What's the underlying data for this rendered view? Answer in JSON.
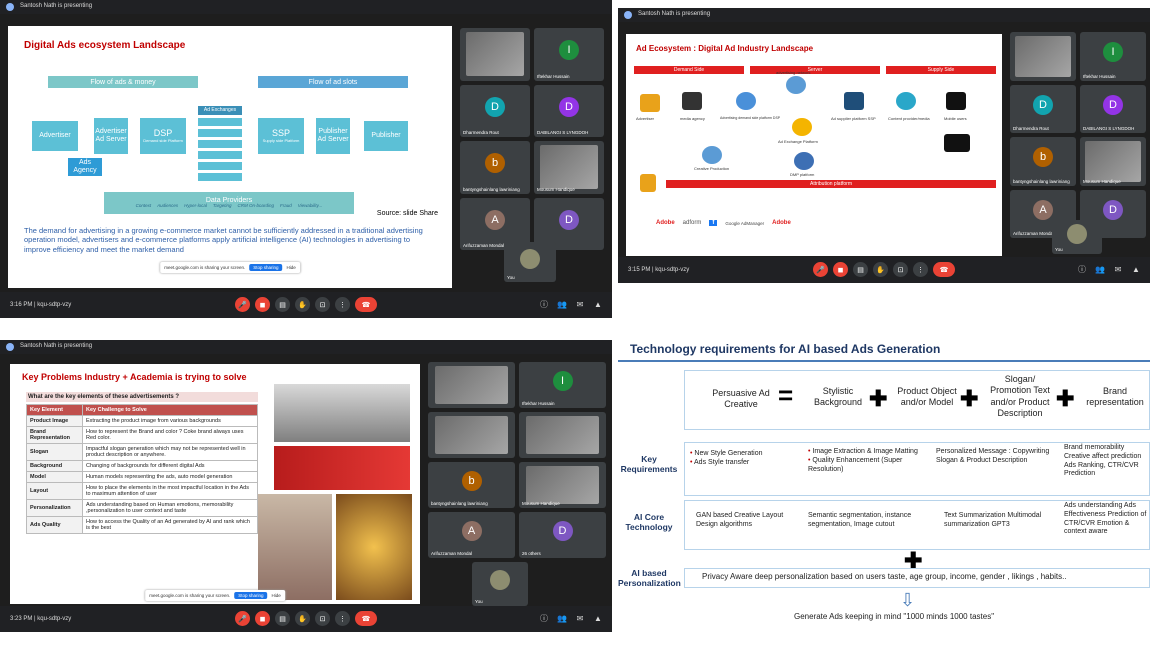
{
  "q1": {
    "presenting": "Santosh Nath is presenting",
    "title": "Digital Ads ecosystem Landscape",
    "flow_left": "Flow of ads & money",
    "flow_right": "Flow of ad slots",
    "boxes": {
      "advertiser": "Advertiser",
      "ad_server_l": "Advertiser Ad Server",
      "ads_agency": "Ads Agency",
      "dsp": "DSP",
      "dsp_sub": "Demand side Platform",
      "ad_exchanges": "Ad Exchanges",
      "ssp": "SSP",
      "ssp_sub": "Supply side Platform",
      "ad_server_r": "Publisher Ad Server",
      "publisher": "Publisher"
    },
    "data_providers": "Data Providers",
    "data_items": [
      "Context",
      "Audiences",
      "Hyper-local",
      "Targeting",
      "CRM On-boarding",
      "Fraud",
      "Viewability..."
    ],
    "source": "Source: slide Share",
    "body": "The demand for advertising in a growing e-commerce market cannot be sufficiently addressed in a traditional advertising operation model, advertisers and e-commerce platforms apply artificial intelligence (AI) technologies in advertising to improve efficiency and meet the market demand",
    "share_msg": "meet.google.com is sharing your screen.",
    "stop_sharing": "Stop sharing",
    "hide": "Hide",
    "time": "3:16 PM | kqu-sdtp-vzy",
    "participants": [
      {
        "name": "",
        "initial": "",
        "type": "video"
      },
      {
        "name": "Iftekhar Hussain",
        "initial": "I",
        "color": "#1e8e3e"
      },
      {
        "name": "Dharmendra Rout",
        "initial": "D",
        "color": "#12a4af"
      },
      {
        "name": "DABILANGI S LYNGDOH",
        "initial": "D",
        "color": "#9334e6"
      },
      {
        "name": "bantyngshainlang lawriniang",
        "initial": "b",
        "color": "#b06000"
      },
      {
        "name": "Mousum Handique",
        "initial": "",
        "type": "video"
      },
      {
        "name": "Arifuzzaman Mondal",
        "initial": "A",
        "color": "#8d6e63"
      },
      {
        "name": "25 others",
        "initial": "D",
        "color": "#7e57c2"
      }
    ],
    "you": "You"
  },
  "q2": {
    "presenting": "Santosh Nath is presenting",
    "title": "Ad Ecosystem : Digital Ad Industry Landscape",
    "headers": [
      "Demand Side",
      "Server",
      "Supply Side"
    ],
    "labels": [
      "Advertiser",
      "media agency",
      "Advertising demand side platform DSP",
      "advertising network",
      "Ad Exchange Platform",
      "Ad supplier platform SSP",
      "Content provider/media",
      "Mobile users",
      "DMP platform",
      "Creative Production"
    ],
    "attribution": "Attribution platform",
    "logo_text": [
      "Adobe",
      "adform",
      "f",
      "Google AdManager",
      "Adobe"
    ],
    "time": "3:15 PM | kqu-sdtp-vzy",
    "participants": [
      {
        "name": "",
        "initial": "",
        "type": "video"
      },
      {
        "name": "Iftekhar Hussain",
        "initial": "I",
        "color": "#1e8e3e"
      },
      {
        "name": "Dharmendra Rout",
        "initial": "D",
        "color": "#12a4af"
      },
      {
        "name": "DABILANGI S LYNGDOH",
        "initial": "D",
        "color": "#9334e6"
      },
      {
        "name": "bantyngshainlang lawriniang",
        "initial": "b",
        "color": "#b06000"
      },
      {
        "name": "Mousum Handique",
        "initial": "",
        "type": "video"
      },
      {
        "name": "Arifuzzaman Mondal",
        "initial": "A",
        "color": "#8d6e63"
      },
      {
        "name": "25 others",
        "initial": "D",
        "color": "#7e57c2"
      }
    ],
    "you": "You"
  },
  "q3": {
    "presenting": "Santosh Nath is presenting",
    "title": "Key Problems Industry + Academia is trying to solve",
    "question": "What are the key elements of these advertisements ?",
    "col_headers": [
      "Key Element",
      "Key Challenge to Solve"
    ],
    "rows": [
      [
        "Product Image",
        "Extracting the product image from various backgrounds"
      ],
      [
        "Brand Representation",
        "How to represent the Brand and color ? Coke brand always uses Red color."
      ],
      [
        "Slogan",
        "Impactful slogan generation which may not be represented well in product description or anywhere."
      ],
      [
        "Background",
        "Changing of backgrounds for different digital Ads"
      ],
      [
        "Model",
        "Human models representing the ads, auto model generation"
      ],
      [
        "Layout",
        "How to place the elements in the most impactful location in the Ads to maximum attention of user"
      ],
      [
        "Personalization",
        "Ads understanding based on Human emotions, memorability ,personalization to user context and taste"
      ],
      [
        "Ads Quality",
        "How to access the Quality of an Ad generated by AI and rank which is the best"
      ]
    ],
    "share_msg": "meet.google.com is sharing your screen.",
    "stop_sharing": "Stop sharing",
    "hide": "Hide",
    "time": "3:23 PM | kqu-sdtp-vzy",
    "participants": [
      {
        "name": "",
        "initial": "",
        "type": "video"
      },
      {
        "name": "Iftekhar Hussain",
        "initial": "I",
        "color": "#1e8e3e"
      },
      {
        "name": "",
        "initial": "",
        "type": "video"
      },
      {
        "name": "",
        "initial": "",
        "type": "video"
      },
      {
        "name": "bantyngshainlang lawriniang",
        "initial": "b",
        "color": "#b06000"
      },
      {
        "name": "Mousum Handique",
        "initial": "",
        "type": "video"
      },
      {
        "name": "Arifuzzaman Mondal",
        "initial": "A",
        "color": "#8d6e63"
      },
      {
        "name": "26 others",
        "initial": "D",
        "color": "#7e57c2"
      }
    ],
    "you": "You"
  },
  "q4": {
    "title": "Technology requirements for AI based Ads Generation",
    "eq_left": "Persuasive Ad Creative",
    "eq_items": [
      "Stylistic Background",
      "Product Object and/or Model",
      "Slogan/ Promotion Text and/or Product Description",
      "Brand representation"
    ],
    "row_labels": [
      "Key Requirements",
      "AI Core Technology",
      "AI based Personalization"
    ],
    "req": [
      [
        "New Style Generation",
        "Ads Style transfer"
      ],
      [
        "Image Extraction & Image Matting",
        "Quality Enhancement (Super Resolution)"
      ],
      [
        "Personalized Message : Copywriting Slogan & Product Description"
      ],
      [
        "Brand memorability",
        "Creative affect prediction",
        "Ads Ranking, CTR/CVR Prediction"
      ]
    ],
    "core": [
      "GAN based Creative Layout Design algorithms",
      "Semantic segmentation, instance segmentation, Image cutout",
      "Text Summarization Multimodal summarization GPT3",
      "Ads understanding Ads Effectiveness Prediction of CTR/CVR Emotion & context aware"
    ],
    "personalization": "Privacy Aware deep personalization based on users taste, age group, income, gender , likings , habits..",
    "footer": "Generate Ads keeping in mind \"1000 minds 1000 tastes\""
  }
}
